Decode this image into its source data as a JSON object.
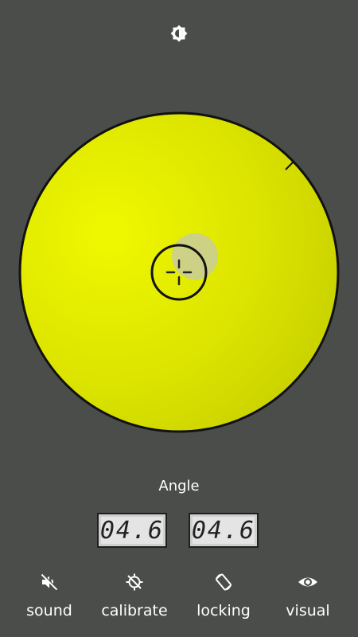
{
  "toolbar_top": {
    "brightness_icon": "brightness-icon"
  },
  "level": {
    "bubble_color": "#d9dd00",
    "crosshair_icon": "crosshair-icon"
  },
  "readout": {
    "title": "Angle",
    "x_value": "04.6",
    "y_value": "04.6"
  },
  "toolbar": {
    "items": [
      {
        "label": "sound",
        "icon": "sound-off-icon"
      },
      {
        "label": "calibrate",
        "icon": "calibrate-icon"
      },
      {
        "label": "locking",
        "icon": "screen-rotation-icon"
      },
      {
        "label": "visual",
        "icon": "eye-icon"
      }
    ]
  },
  "colors": {
    "background": "#4b4d4b",
    "bubble_fill": "#e6ee00",
    "outline": "#111111",
    "text": "#ffffff"
  }
}
